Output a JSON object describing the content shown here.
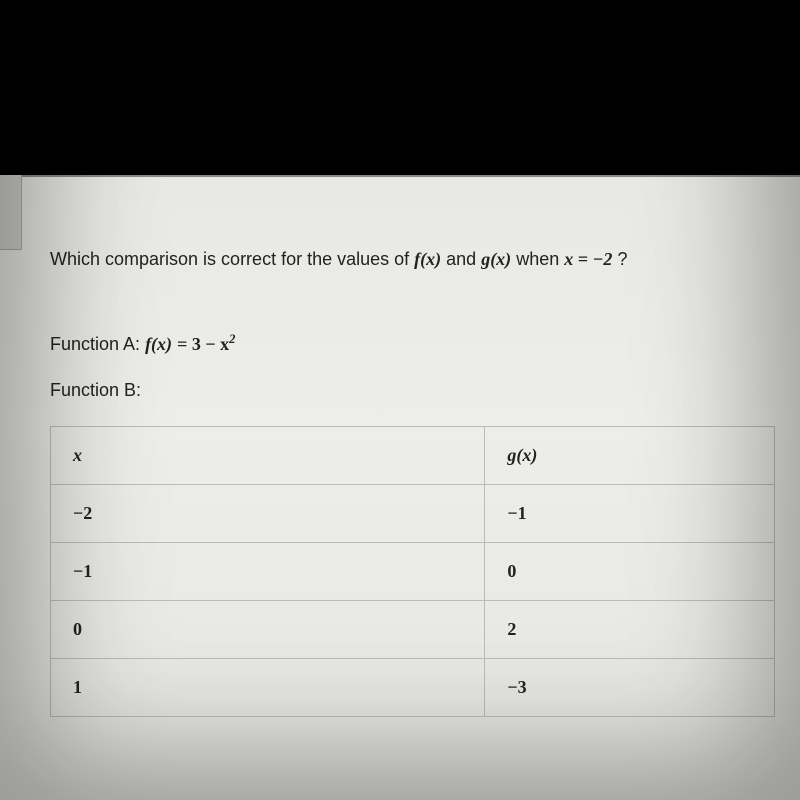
{
  "question": {
    "prefix": "Which comparison is correct for the values of ",
    "fx": "f(x)",
    "mid1": " and ",
    "gx": "g(x)",
    "mid2": " when ",
    "xeq": "x = −2",
    "suffix": " ?"
  },
  "functionA": {
    "label": "Function A: ",
    "expr_lhs": "f(x)",
    "expr_eq": " = ",
    "expr_rhs": "3 − x",
    "expr_exp": "2"
  },
  "functionB": {
    "label": "Function B:"
  },
  "table": {
    "headers": {
      "x": "x",
      "gx": "g(x)"
    },
    "rows": [
      {
        "x": "−2",
        "gx": "−1"
      },
      {
        "x": "−1",
        "gx": "0"
      },
      {
        "x": "0",
        "gx": "2"
      },
      {
        "x": "1",
        "gx": "−3"
      }
    ]
  }
}
